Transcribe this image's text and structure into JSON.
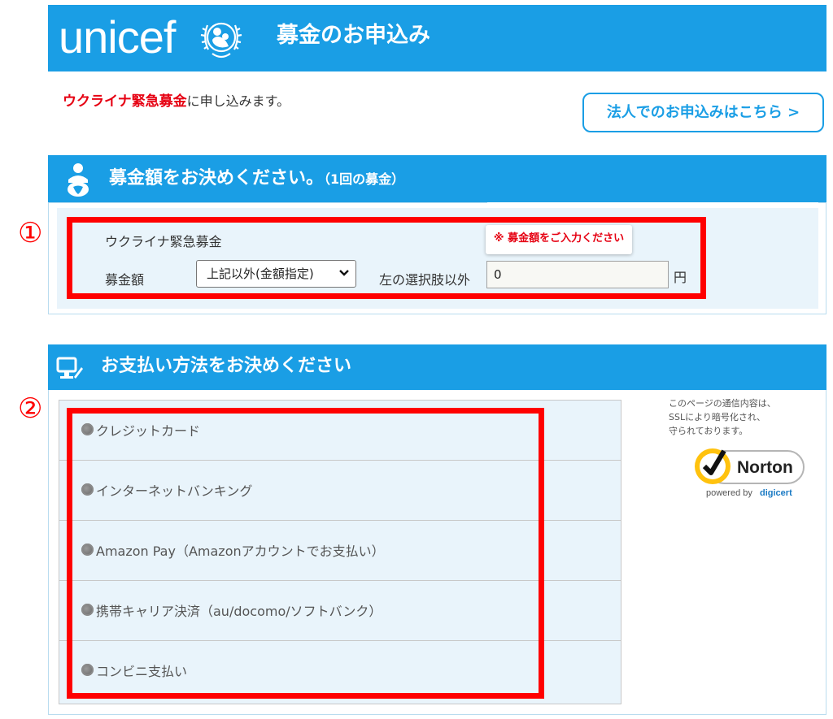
{
  "header": {
    "logo_text": "unicef",
    "title": "募金のお申込み"
  },
  "intro": {
    "fund_highlight": "ウクライナ緊急募金",
    "suffix": "に申し込みます。"
  },
  "corporate_button": "法人でのお申込みはこちら >",
  "amount_section": {
    "title": "募金額をお決めください。",
    "title_small": "（1回の募金）",
    "fund_name": "ウクライナ緊急募金",
    "amount_label": "募金額",
    "select_value": "上記以外(金額指定)",
    "other_label": "左の選択肢以外",
    "input_value": "0",
    "unit": "円",
    "error_message": "※ 募金額をご入力ください"
  },
  "payment_section": {
    "title": "お支払い方法をお決めください",
    "methods": [
      "クレジットカード",
      "インターネットバンキング",
      "Amazon Pay（Amazonアカウントでお支払い）",
      "携帯キャリア決済（au/docomo/ソフトバンク）",
      "コンビニ支払い"
    ],
    "ssl_note_lines": [
      "このページの通信内容は、",
      "SSLにより暗号化され、",
      "守られております。"
    ],
    "norton": {
      "brand": "Norton",
      "powered_by": "powered by",
      "digicert": "digicert"
    }
  },
  "annotations": {
    "marker_1": "①",
    "marker_2": "②"
  },
  "colors": {
    "brand_blue": "#1a9ee5",
    "error_red": "#e60012",
    "annotation_red": "#ff0000",
    "panel_bg": "#e9f4fb"
  }
}
